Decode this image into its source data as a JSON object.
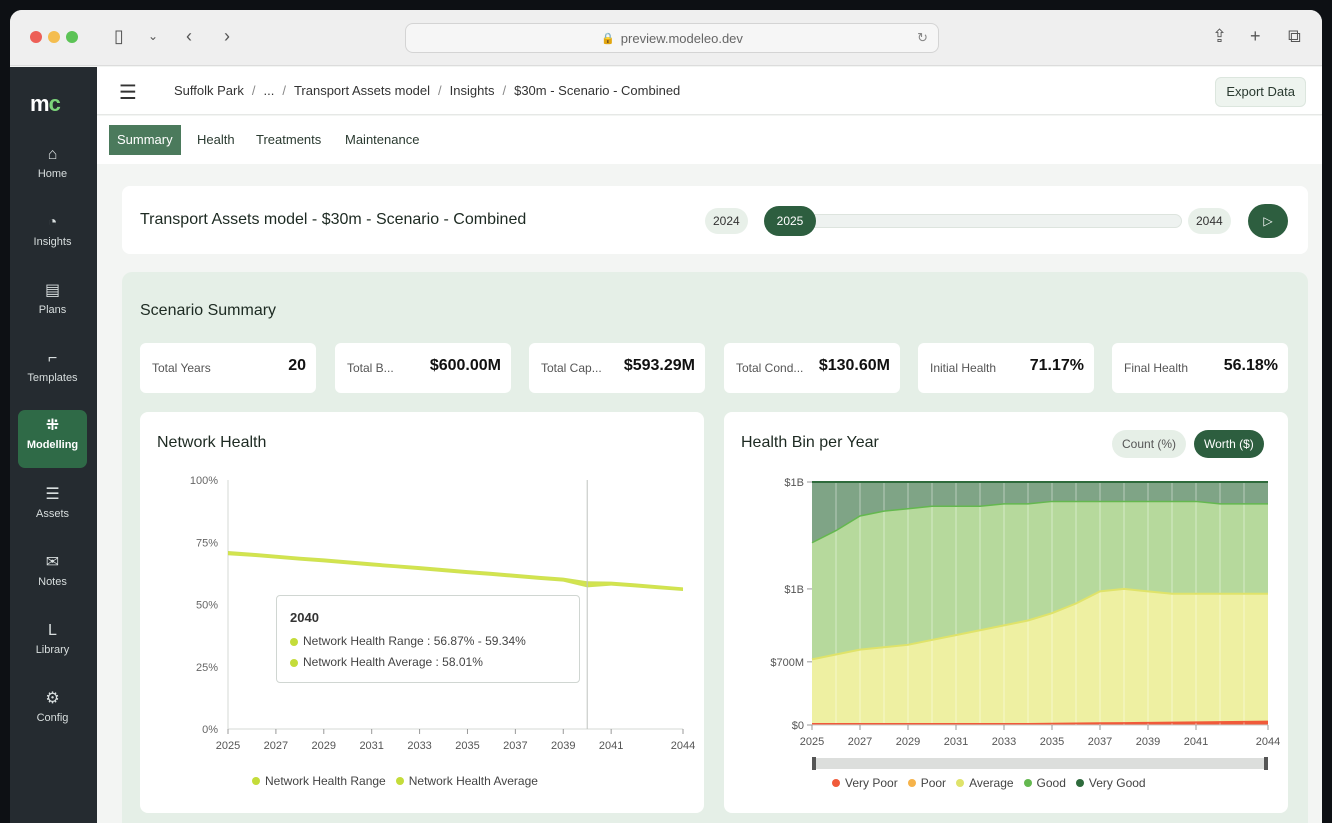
{
  "browser": {
    "url": "preview.modeleo.dev"
  },
  "sidebar": {
    "logo": "mc",
    "items": [
      {
        "label": "Home",
        "icon": "home-icon",
        "glyph": "⌂"
      },
      {
        "label": "Insights",
        "icon": "insights-icon",
        "glyph": "◔"
      },
      {
        "label": "Plans",
        "icon": "plans-icon",
        "glyph": "▤"
      },
      {
        "label": "Templates",
        "icon": "templates-icon",
        "glyph": "⌐"
      },
      {
        "label": "Modelling",
        "icon": "modelling-icon",
        "glyph": "⁜",
        "active": true
      },
      {
        "label": "Assets",
        "icon": "assets-icon",
        "glyph": "☰"
      },
      {
        "label": "Notes",
        "icon": "notes-icon",
        "glyph": "✉"
      },
      {
        "label": "Library",
        "icon": "library-icon",
        "glyph": "L"
      },
      {
        "label": "Config",
        "icon": "config-icon",
        "glyph": "⚙"
      }
    ]
  },
  "topbar": {
    "breadcrumbs": [
      "Suffolk Park",
      "...",
      "Transport Assets model",
      "Insights",
      "$30m - Scenario - Combined"
    ],
    "export_label": "Export Data"
  },
  "tabs": [
    {
      "label": "Summary",
      "active": true
    },
    {
      "label": "Health"
    },
    {
      "label": "Treatments"
    },
    {
      "label": "Maintenance"
    }
  ],
  "scenario": {
    "title": "Transport Assets model - $30m - Scenario - Combined",
    "start_year": "2024",
    "current_year": "2025",
    "end_year": "2044",
    "play_icon": "play-icon"
  },
  "summary": {
    "title": "Scenario Summary",
    "stats": [
      {
        "label": "Total Years",
        "value": "20"
      },
      {
        "label": "Total B...",
        "value": "$600.00M"
      },
      {
        "label": "Total Cap...",
        "value": "$593.29M"
      },
      {
        "label": "Total Cond...",
        "value": "$130.60M"
      },
      {
        "label": "Initial Health",
        "value": "71.17%"
      },
      {
        "label": "Final Health",
        "value": "56.18%"
      }
    ]
  },
  "network_health": {
    "title": "Network Health",
    "tooltip": {
      "year": "2040",
      "range_text": "Network Health Range : 56.87% - 59.34%",
      "avg_text": "Network Health Average : 58.01%"
    },
    "legend": [
      "Network Health Range",
      "Network Health Average"
    ],
    "colors": {
      "range": "#c4dc3a",
      "average": "#d4e44c"
    }
  },
  "health_bin": {
    "title": "Health Bin per Year",
    "toggle_count": "Count (%)",
    "toggle_worth": "Worth ($)",
    "legend": [
      "Very Poor",
      "Poor",
      "Average",
      "Good",
      "Very Good"
    ],
    "colors": {
      "very_poor": "#f05a3a",
      "poor": "#f6b34a",
      "average": "#eef0a2",
      "good": "#b6d99c",
      "very_good": "#7fa486",
      "average_line": "#dfe36a",
      "good_line": "#64b84f",
      "very_good_line": "#2e6b3c"
    }
  },
  "chart_data": [
    {
      "type": "area",
      "title": "Network Health",
      "x": [
        2025,
        2026,
        2027,
        2028,
        2029,
        2030,
        2031,
        2032,
        2033,
        2034,
        2035,
        2036,
        2037,
        2038,
        2039,
        2040,
        2041,
        2042,
        2043,
        2044
      ],
      "x_tick_labels": [
        "2025",
        "2027",
        "2029",
        "2031",
        "2033",
        "2035",
        "2037",
        "2039",
        "2041",
        "2044"
      ],
      "y_tick_labels": [
        "0%",
        "25%",
        "50%",
        "75%",
        "100%"
      ],
      "ylim": [
        0,
        100
      ],
      "series": [
        {
          "name": "Network Health Range",
          "low": [
            69.8,
            69.2,
            68.4,
            67.6,
            66.9,
            66.1,
            65.3,
            64.6,
            63.8,
            63.0,
            62.2,
            61.5,
            60.7,
            59.9,
            59.2,
            56.87,
            57.6,
            56.9,
            56.1,
            55.4
          ],
          "high": [
            71.5,
            70.8,
            70.0,
            69.2,
            68.5,
            67.7,
            66.9,
            66.1,
            65.4,
            64.6,
            63.8,
            63.1,
            62.3,
            61.5,
            60.8,
            59.34,
            59.2,
            58.5,
            57.7,
            56.9
          ]
        },
        {
          "name": "Network Health Average",
          "values": [
            70.6,
            70.0,
            69.2,
            68.4,
            67.7,
            66.9,
            66.1,
            65.3,
            64.6,
            63.8,
            63.0,
            62.3,
            61.5,
            60.7,
            60.0,
            58.01,
            58.4,
            57.7,
            56.9,
            56.18
          ]
        }
      ],
      "highlight_x": 2040
    },
    {
      "type": "area",
      "title": "Health Bin per Year",
      "x": [
        2025,
        2026,
        2027,
        2028,
        2029,
        2030,
        2031,
        2032,
        2033,
        2034,
        2035,
        2036,
        2037,
        2038,
        2039,
        2040,
        2041,
        2042,
        2043,
        2044
      ],
      "x_tick_labels": [
        "2025",
        "2027",
        "2029",
        "2031",
        "2033",
        "2035",
        "2037",
        "2039",
        "2041",
        "2044"
      ],
      "y_tick_labels": [
        "$0",
        "$700M",
        "$1B",
        "$1B"
      ],
      "unit": "cumulative share of total worth",
      "series": [
        {
          "name": "Very Poor",
          "values": [
            0.005,
            0.005,
            0.005,
            0.005,
            0.005,
            0.005,
            0.005,
            0.005,
            0.005,
            0.005,
            0.006,
            0.007,
            0.008,
            0.009,
            0.01,
            0.011,
            0.012,
            0.013,
            0.014,
            0.015
          ]
        },
        {
          "name": "Poor",
          "values": [
            0.27,
            0.29,
            0.31,
            0.32,
            0.33,
            0.35,
            0.37,
            0.39,
            0.41,
            0.43,
            0.46,
            0.5,
            0.55,
            0.56,
            0.55,
            0.54,
            0.54,
            0.54,
            0.54,
            0.54
          ]
        },
        {
          "name": "Average",
          "values": [
            0.27,
            0.29,
            0.31,
            0.32,
            0.33,
            0.35,
            0.37,
            0.39,
            0.41,
            0.43,
            0.46,
            0.5,
            0.55,
            0.56,
            0.55,
            0.54,
            0.54,
            0.54,
            0.54,
            0.54
          ]
        },
        {
          "name": "Good",
          "values": [
            0.75,
            0.8,
            0.86,
            0.88,
            0.89,
            0.9,
            0.9,
            0.9,
            0.91,
            0.91,
            0.92,
            0.92,
            0.92,
            0.92,
            0.92,
            0.92,
            0.92,
            0.91,
            0.91,
            0.91
          ]
        },
        {
          "name": "Very Good",
          "values": [
            1,
            1,
            1,
            1,
            1,
            1,
            1,
            1,
            1,
            1,
            1,
            1,
            1,
            1,
            1,
            1,
            1,
            1,
            1,
            1
          ]
        }
      ]
    }
  ]
}
